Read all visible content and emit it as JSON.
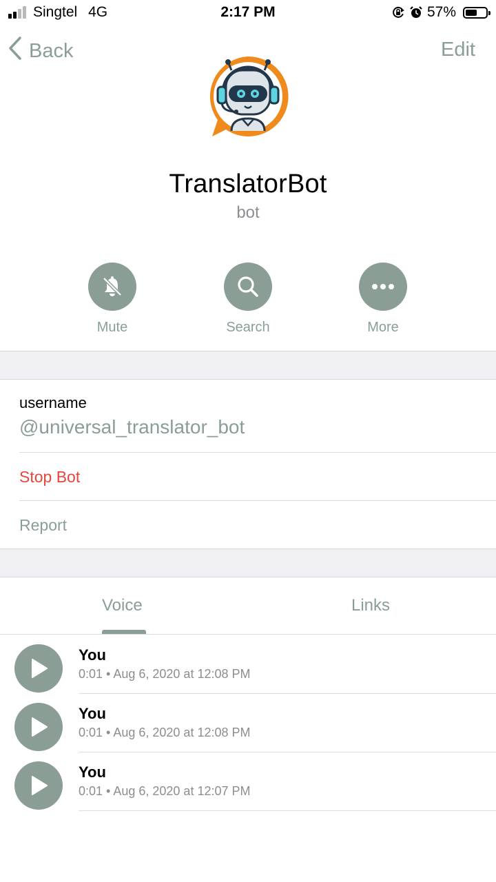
{
  "status_bar": {
    "carrier": "Singtel",
    "network": "4G",
    "time": "2:17 PM",
    "battery_percent": "57%",
    "battery_level": 0.57,
    "signal_bars_active": 2,
    "signal_bars_total": 4,
    "icons": [
      "orientation-lock-icon",
      "alarm-icon",
      "battery-icon"
    ]
  },
  "nav": {
    "back_label": "Back",
    "edit_label": "Edit"
  },
  "profile": {
    "name": "TranslatorBot",
    "subtitle": "bot",
    "avatar_icon": "robot-headset-avatar"
  },
  "actions": [
    {
      "label": "Mute",
      "icon": "bell-off-icon"
    },
    {
      "label": "Search",
      "icon": "search-icon"
    },
    {
      "label": "More",
      "icon": "ellipsis-icon"
    }
  ],
  "info": {
    "username_caption": "username",
    "username_value": "@universal_translator_bot",
    "stop_bot_label": "Stop Bot",
    "report_label": "Report"
  },
  "tabs": {
    "voice": "Voice",
    "links": "Links",
    "active": "voice"
  },
  "voice_items": [
    {
      "author": "You",
      "meta": "0:01 • Aug 6, 2020 at 12:08 PM"
    },
    {
      "author": "You",
      "meta": "0:01 • Aug 6, 2020 at 12:08 PM"
    },
    {
      "author": "You",
      "meta": "0:01 • Aug 6, 2020 at 12:07 PM"
    }
  ],
  "colors": {
    "accent": "#8a9e95",
    "destructive": "#e5463b",
    "secondary_text": "#8d8d92",
    "section_background": "#efeff4",
    "avatar_orange": "#f08a1c"
  }
}
